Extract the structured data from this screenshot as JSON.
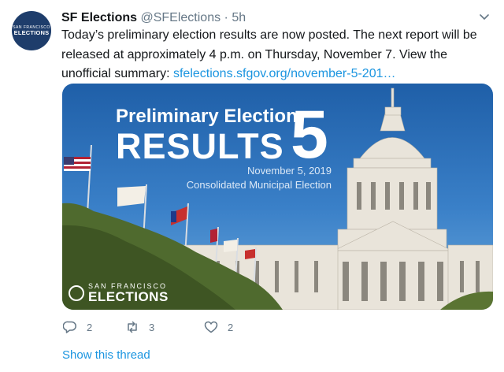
{
  "account": {
    "display_name": "SF Elections",
    "handle": "@SFElections",
    "separator": " · ",
    "time": "5h",
    "avatar_line1": "SAN FRANCISCO",
    "avatar_line2": "ELECTIONS"
  },
  "tweet": {
    "text": "Today’s preliminary election results are now posted. The next report will be released at approximately 4 p.m. on Thursday, November 7. View the unofficial summary: ",
    "link": "sfelections.sfgov.org/november-5-201…"
  },
  "card": {
    "headline": "Preliminary Election",
    "big": "RESULTS",
    "number": "5",
    "date": "November 5, 2019",
    "subtitle": "Consolidated Municipal Election",
    "logo_line1": "SAN FRANCISCO",
    "logo_line2": "ELECTIONS"
  },
  "actions": {
    "replies": "2",
    "retweets": "3",
    "likes": "2"
  },
  "show_thread": "Show this thread",
  "colors": {
    "link": "#1b95e0",
    "meta": "#657786",
    "avatar_bg": "#1e3d6b"
  }
}
